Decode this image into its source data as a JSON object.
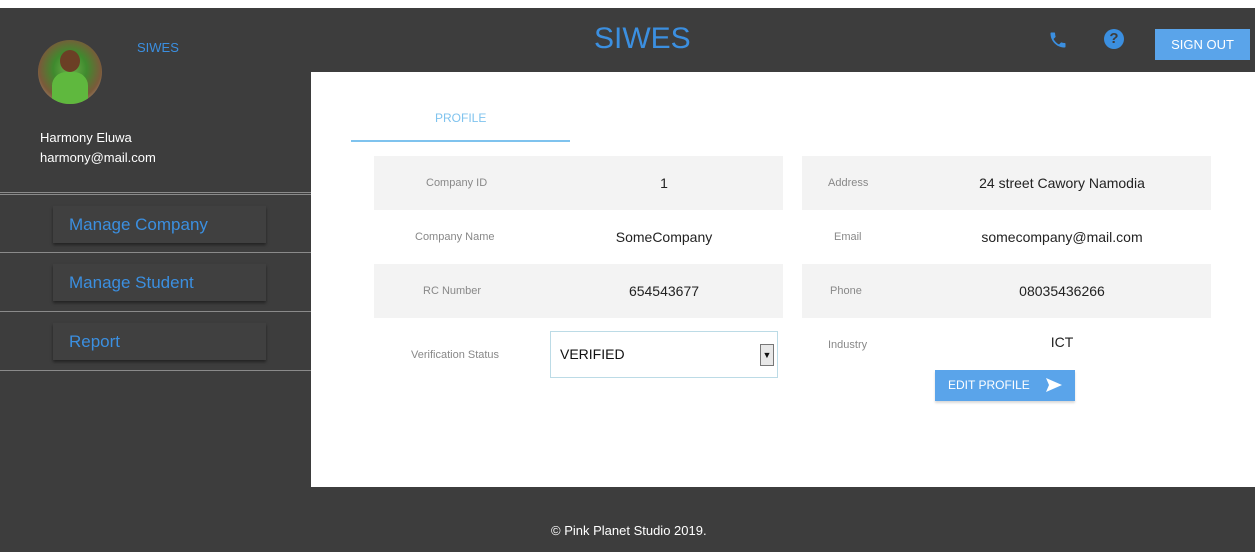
{
  "sidebar": {
    "brand": "SIWES",
    "user_name": "Harmony Eluwa",
    "user_email": "harmony@mail.com",
    "avatar_icon": "user-avatar-photo",
    "nav": [
      {
        "label": "Manage Company"
      },
      {
        "label": "Manage Student"
      },
      {
        "label": "Report"
      }
    ]
  },
  "header": {
    "title": "SIWES",
    "phone_icon": "phone-icon",
    "help_icon": "help-icon",
    "help_glyph": "?",
    "signout_label": "SIGN OUT"
  },
  "main": {
    "tab_label": "PROFILE",
    "left_fields": [
      {
        "label": "Company ID",
        "value": "1"
      },
      {
        "label": "Company Name",
        "value": "SomeCompany"
      },
      {
        "label": "RC Number",
        "value": "654543677"
      },
      {
        "label": "Verification Status",
        "value": "VERIFIED"
      }
    ],
    "right_fields": [
      {
        "label": "Address",
        "value": "24 street Cawory Namodia"
      },
      {
        "label": "Email",
        "value": "somecompany@mail.com"
      },
      {
        "label": "Phone",
        "value": "08035436266"
      },
      {
        "label": "Industry",
        "value": "ICT"
      }
    ],
    "edit_button": "EDIT PROFILE",
    "edit_icon": "send-icon"
  },
  "footer": {
    "text": "© Pink Planet Studio 2019."
  },
  "colors": {
    "accent": "#3b8fe0",
    "button": "#5aa4ea",
    "dark": "#3d3d3d",
    "tab": "#7fc3ee"
  }
}
